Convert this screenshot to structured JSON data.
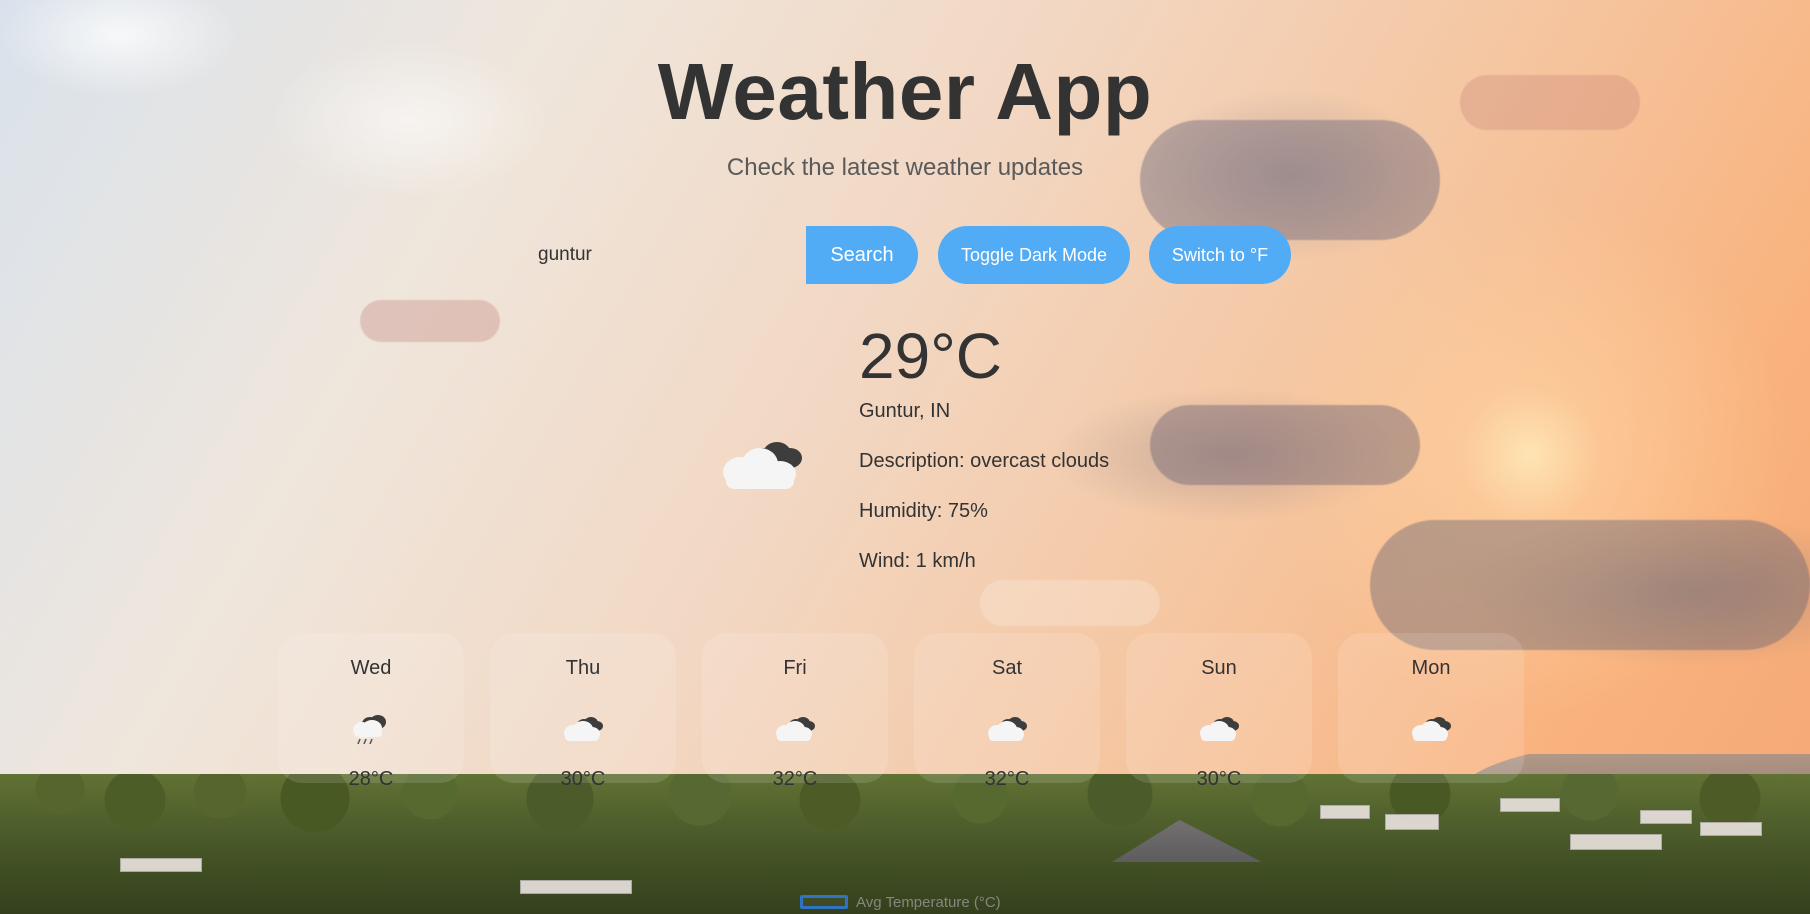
{
  "app": {
    "title": "Weather App",
    "subtitle": "Check the latest weather updates"
  },
  "controls": {
    "search_value": "guntur",
    "search_button": "Search",
    "toggle_dark_mode": "Toggle Dark Mode",
    "switch_unit": "Switch to °F",
    "accent_color": "#52abf5"
  },
  "current": {
    "temperature": "29°C",
    "location": "Guntur, IN",
    "description": "Description: overcast clouds",
    "humidity": "Humidity: 75%",
    "wind": "Wind: 1 km/h",
    "icon": "cloudy-icon"
  },
  "forecast": [
    {
      "day": "Wed",
      "temp": "28°C",
      "icon": "rain-cloud-icon"
    },
    {
      "day": "Thu",
      "temp": "30°C",
      "icon": "cloudy-icon"
    },
    {
      "day": "Fri",
      "temp": "32°C",
      "icon": "cloudy-icon"
    },
    {
      "day": "Sat",
      "temp": "32°C",
      "icon": "cloudy-icon"
    },
    {
      "day": "Sun",
      "temp": "30°C",
      "icon": "cloudy-icon"
    },
    {
      "day": "Mon",
      "temp": "",
      "icon": "cloudy-icon"
    }
  ],
  "chart": {
    "legend_label": "Avg Temperature (°C)",
    "legend_color": "#2d82f0"
  }
}
